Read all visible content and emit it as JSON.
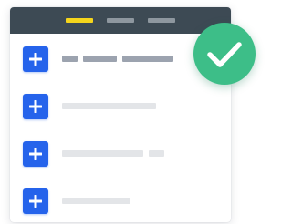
{
  "colors": {
    "header_bg": "#3d4a54",
    "tab_active": "#f5d51c",
    "tab_inactive": "#8e979f",
    "add_button": "#2563eb",
    "add_icon": "#ffffff",
    "bar_dark": "#9ca3af",
    "bar_light": "#e3e5e8",
    "check_badge": "#3dbe88",
    "check_icon": "#ffffff"
  },
  "header": {
    "tabs": [
      {
        "state": "active"
      },
      {
        "state": "inactive"
      },
      {
        "state": "inactive"
      }
    ]
  },
  "list": {
    "items": [
      {
        "action_icon": "plus-icon",
        "placeholder_style": "dark"
      },
      {
        "action_icon": "plus-icon",
        "placeholder_style": "light"
      },
      {
        "action_icon": "plus-icon",
        "placeholder_style": "light"
      },
      {
        "action_icon": "plus-icon",
        "placeholder_style": "light"
      }
    ]
  },
  "status": {
    "icon": "checkmark-icon",
    "state": "success"
  }
}
